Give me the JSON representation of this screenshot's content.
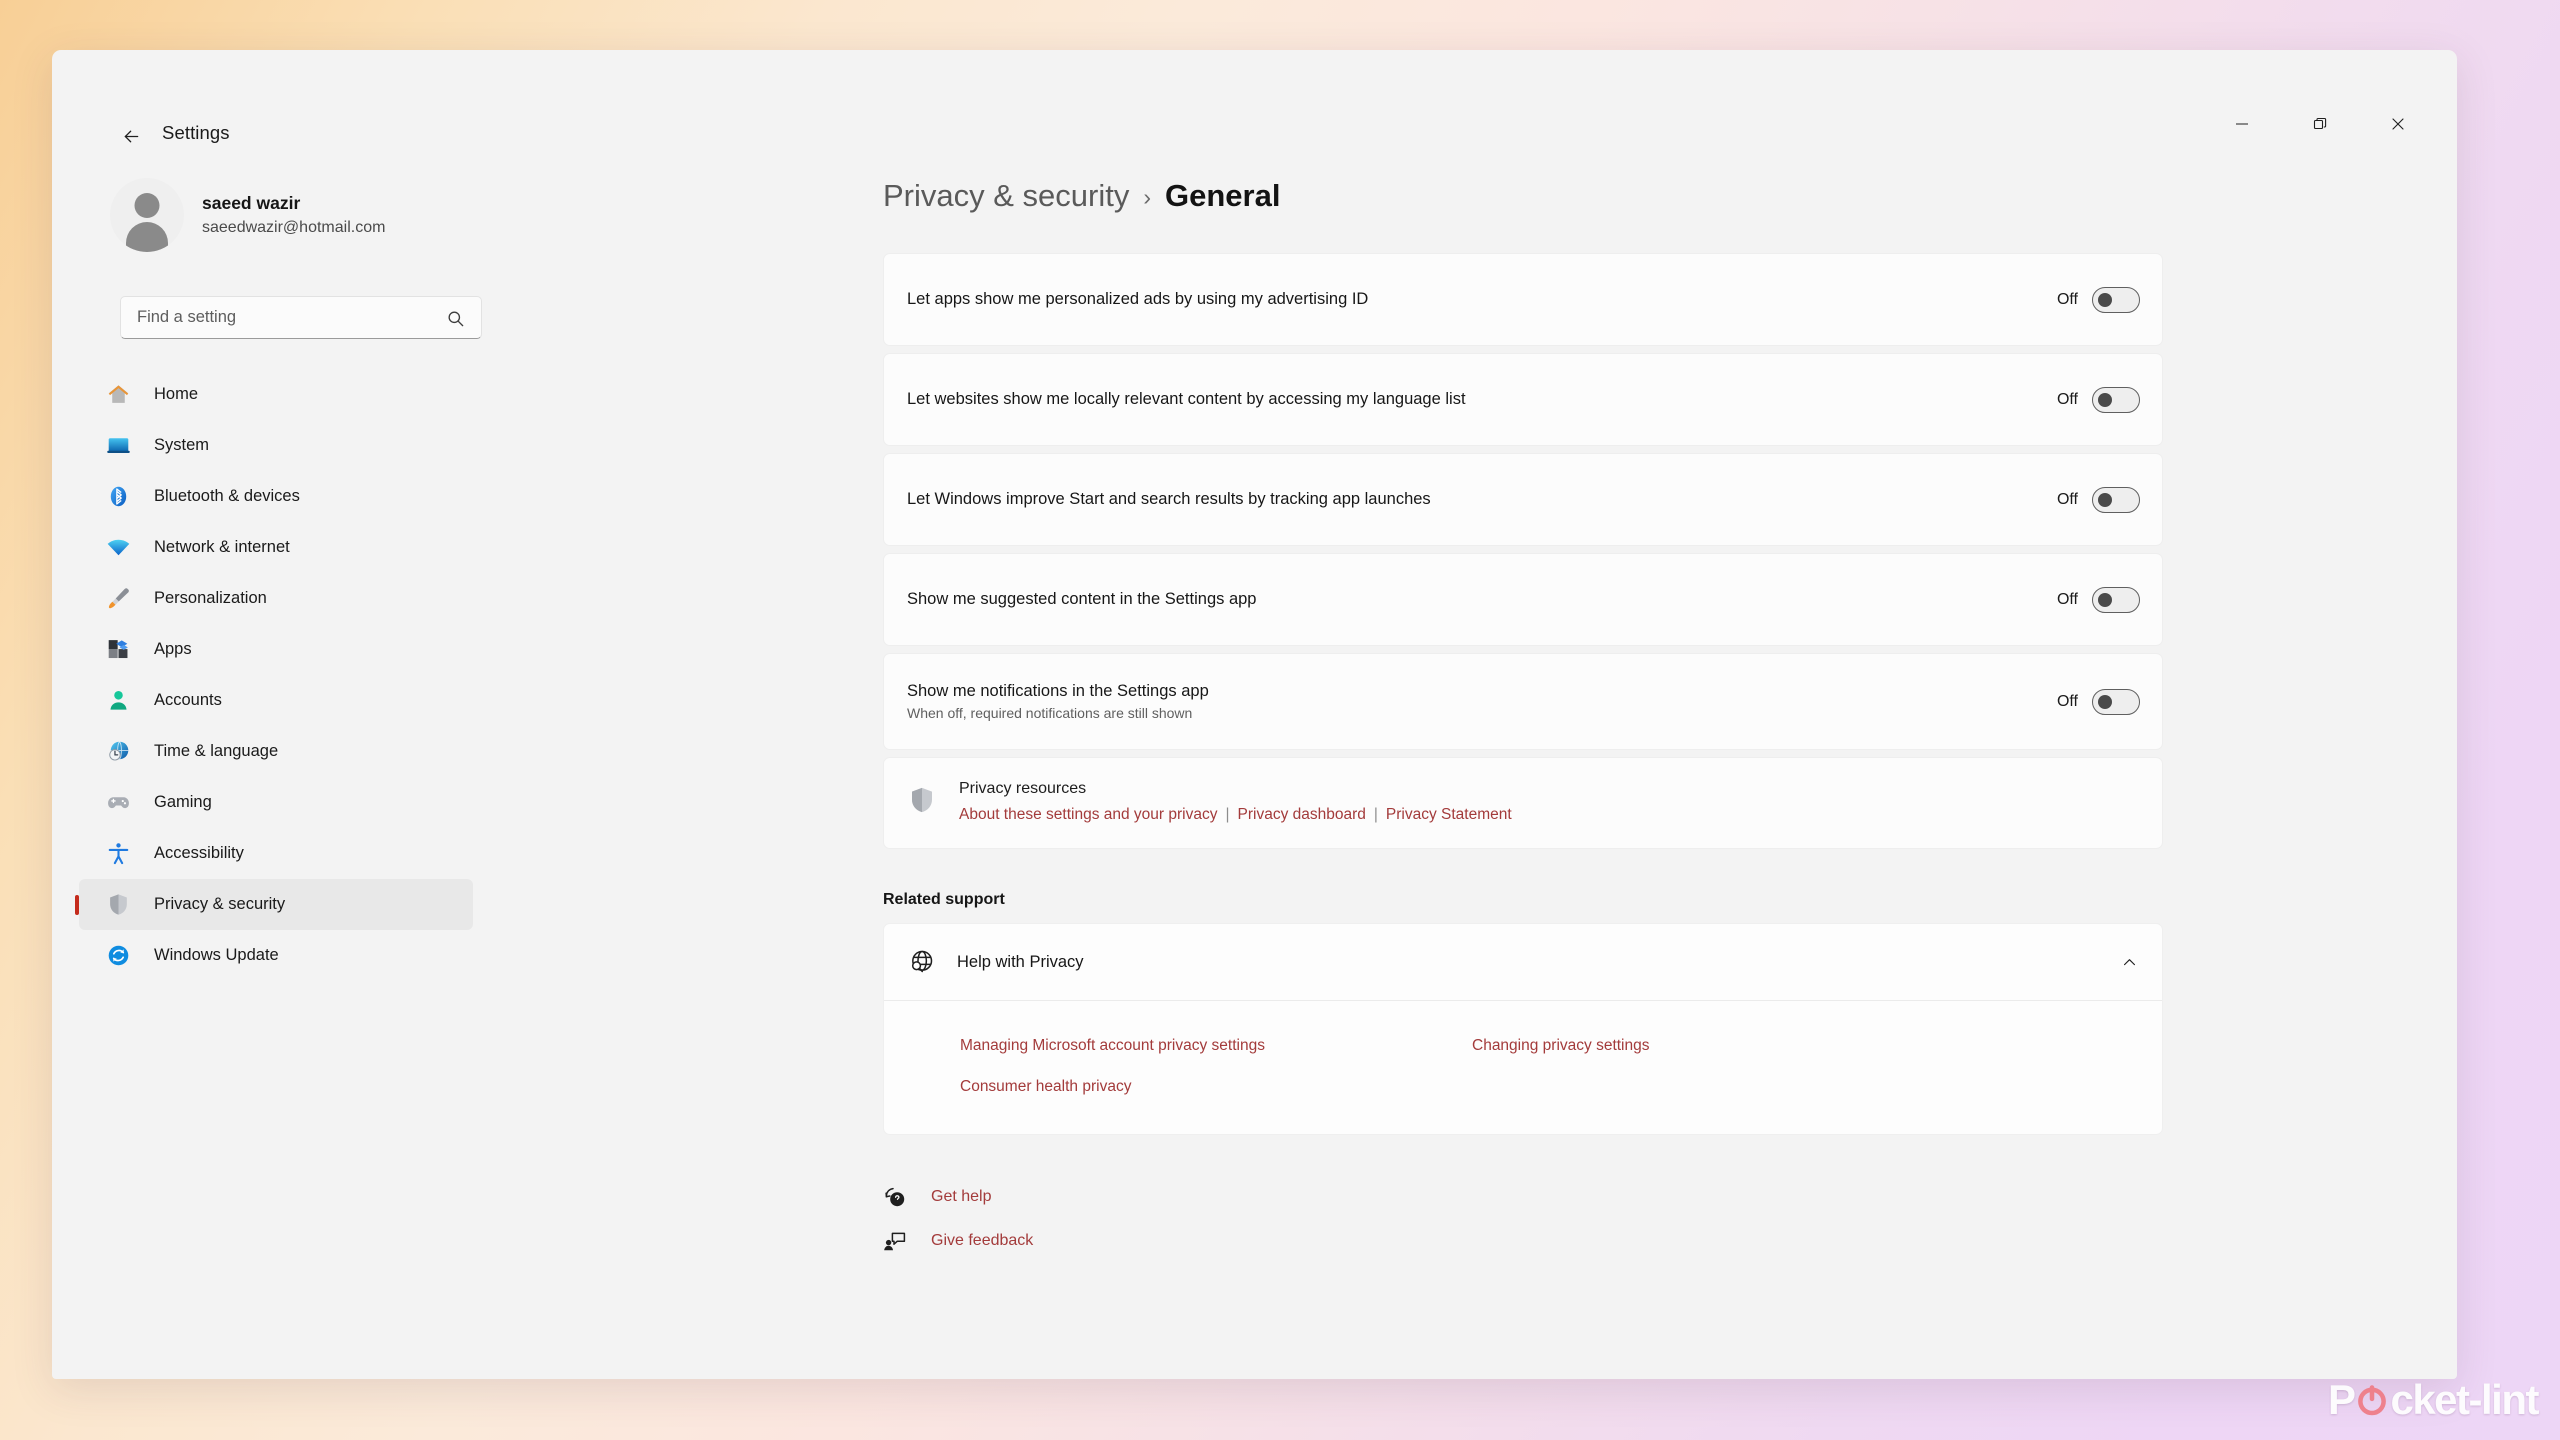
{
  "window": {
    "title": "Settings",
    "back_icon": "back-arrow-icon",
    "controls": {
      "minimize": "minimize-icon",
      "maximize": "maximize-icon",
      "close": "close-icon"
    }
  },
  "account": {
    "name": "saeed wazir",
    "email": "saeedwazir@hotmail.com",
    "avatar": "user-avatar-icon"
  },
  "search": {
    "placeholder": "Find a setting",
    "value": "",
    "icon": "search-icon"
  },
  "sidebar": {
    "items": [
      {
        "label": "Home",
        "icon": "home-icon",
        "selected": false
      },
      {
        "label": "System",
        "icon": "system-icon",
        "selected": false
      },
      {
        "label": "Bluetooth & devices",
        "icon": "bluetooth-icon",
        "selected": false
      },
      {
        "label": "Network & internet",
        "icon": "wifi-icon",
        "selected": false
      },
      {
        "label": "Personalization",
        "icon": "paintbrush-icon",
        "selected": false
      },
      {
        "label": "Apps",
        "icon": "apps-icon",
        "selected": false
      },
      {
        "label": "Accounts",
        "icon": "accounts-icon",
        "selected": false
      },
      {
        "label": "Time & language",
        "icon": "clock-globe-icon",
        "selected": false
      },
      {
        "label": "Gaming",
        "icon": "gamepad-icon",
        "selected": false
      },
      {
        "label": "Accessibility",
        "icon": "accessibility-icon",
        "selected": false
      },
      {
        "label": "Privacy & security",
        "icon": "shield-icon",
        "selected": true
      },
      {
        "label": "Windows Update",
        "icon": "update-icon",
        "selected": false
      }
    ]
  },
  "breadcrumb": {
    "parent": "Privacy & security",
    "separator": "›",
    "current": "General"
  },
  "settings": [
    {
      "title": "Let apps show me personalized ads by using my advertising ID",
      "subtitle": "",
      "state": "Off",
      "checked": false
    },
    {
      "title": "Let websites show me locally relevant content by accessing my language list",
      "subtitle": "",
      "state": "Off",
      "checked": false
    },
    {
      "title": "Let Windows improve Start and search results by tracking app launches",
      "subtitle": "",
      "state": "Off",
      "checked": false
    },
    {
      "title": "Show me suggested content in the Settings app",
      "subtitle": "",
      "state": "Off",
      "checked": false
    },
    {
      "title": "Show me notifications in the Settings app",
      "subtitle": "When off, required notifications are still shown",
      "state": "Off",
      "checked": false
    }
  ],
  "privacy_resources": {
    "icon": "shield-icon",
    "title": "Privacy resources",
    "links": [
      "About these settings and your privacy",
      "Privacy dashboard",
      "Privacy Statement"
    ],
    "separator": "|"
  },
  "related_support": {
    "heading": "Related support",
    "expander": {
      "icon": "globe-help-icon",
      "title": "Help with Privacy",
      "chevron": "chevron-up-icon",
      "expanded": true
    },
    "links": [
      "Managing Microsoft account privacy settings",
      "Changing privacy settings",
      "Consumer health privacy"
    ]
  },
  "footer_links": [
    {
      "label": "Get help",
      "icon": "get-help-icon"
    },
    {
      "label": "Give feedback",
      "icon": "give-feedback-icon"
    }
  ],
  "watermark": {
    "part1": "P",
    "part2": "cket-lint",
    "icon": "power-icon"
  },
  "colors": {
    "accent_selected": "#c42b1c",
    "link": "#a33b3b",
    "window_bg": "#f3f3f3"
  }
}
